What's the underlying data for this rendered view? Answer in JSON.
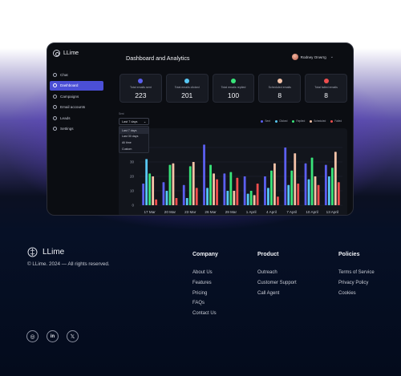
{
  "brand": {
    "name": "LLime"
  },
  "sidebar": {
    "items": [
      {
        "label": "Chat",
        "active": false
      },
      {
        "label": "Dashboard",
        "active": true
      },
      {
        "label": "Campaigns",
        "active": false
      },
      {
        "label": "Email accounts",
        "active": false
      },
      {
        "label": "Leads",
        "active": false
      },
      {
        "label": "Settings",
        "active": false
      }
    ]
  },
  "header": {
    "title": "Dashboard and Analytics",
    "user": "Rodney Onwrrg"
  },
  "stats": [
    {
      "label": "Total emails sent",
      "value": "223",
      "color": "#5b5ff0"
    },
    {
      "label": "Total emails clicked",
      "value": "201",
      "color": "#58c8f4"
    },
    {
      "label": "Total emails replied",
      "value": "100",
      "color": "#39e57a"
    },
    {
      "label": "Scheduled emails",
      "value": "8",
      "color": "#f5c3a8"
    },
    {
      "label": "Total failed emails",
      "value": "8",
      "color": "#ef4e4e"
    }
  ],
  "chart_controls": {
    "section_label": "Sent",
    "range_selected": "Last 7 days",
    "range_options": [
      "Last 7 days",
      "Last 30 days",
      "All time",
      "Custom"
    ]
  },
  "chart_data": {
    "type": "bar",
    "categories": [
      "17 Mar",
      "20 Mar",
      "23 Mar",
      "26 Mar",
      "29 Mar",
      "1 April",
      "4 April",
      "7 April",
      "10 April",
      "13 April"
    ],
    "series": [
      {
        "name": "Sent",
        "color": "#5b5ff0",
        "values": [
          15,
          16,
          14,
          42,
          22,
          20,
          20,
          40,
          29,
          28
        ]
      },
      {
        "name": "Clicked",
        "color": "#58c8f4",
        "values": [
          32,
          10,
          5,
          12,
          10,
          8,
          12,
          14,
          18,
          20
        ]
      },
      {
        "name": "Replied",
        "color": "#39e57a",
        "values": [
          22,
          28,
          27,
          28,
          23,
          10,
          24,
          24,
          33,
          26
        ]
      },
      {
        "name": "Scheduled",
        "color": "#f5c3a8",
        "values": [
          20,
          29,
          30,
          22,
          10,
          7,
          29,
          36,
          20,
          37
        ]
      },
      {
        "name": "Failed",
        "color": "#ef4e4e",
        "values": [
          4,
          5,
          12,
          18,
          19,
          15,
          6,
          15,
          14,
          16
        ]
      }
    ],
    "ylim": [
      0,
      50
    ],
    "yticks": [
      0,
      10,
      20,
      30,
      40
    ]
  },
  "footer": {
    "brand": "LLime",
    "copyright": "© LLime. 2024 — All rights reserved.",
    "columns": [
      {
        "title": "Company",
        "links": [
          "About Us",
          "Features",
          "Pricing",
          "FAQs",
          "Contact Us"
        ]
      },
      {
        "title": "Product",
        "links": [
          "Outreach",
          "Customer Support",
          "Call Agent"
        ]
      },
      {
        "title": "Policies",
        "links": [
          "Terms of Service",
          "Privacy Policy",
          "Cookies"
        ]
      }
    ],
    "socials": [
      {
        "name": "discord",
        "glyph": "◎"
      },
      {
        "name": "linkedin",
        "glyph": "in"
      },
      {
        "name": "x",
        "glyph": "𝕏"
      }
    ]
  }
}
